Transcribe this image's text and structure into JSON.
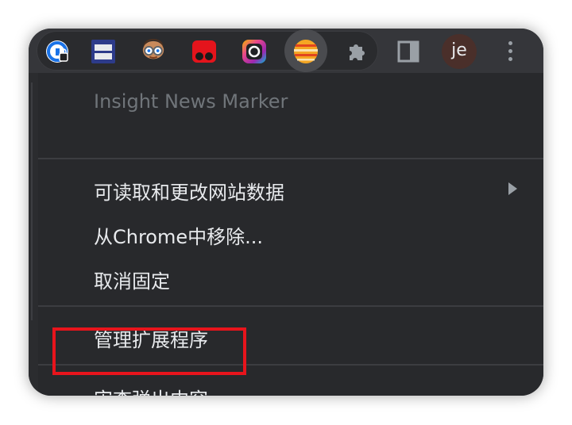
{
  "toolbar": {
    "extensions": [
      {
        "icon": "password-manager-icon"
      },
      {
        "icon": "notes-extension-icon"
      },
      {
        "icon": "glasses-face-extension-icon"
      },
      {
        "icon": "red-gamepad-extension-icon"
      },
      {
        "icon": "rainbow-camera-extension-icon"
      },
      {
        "icon": "insight-news-marker-icon",
        "active": true
      },
      {
        "icon": "puzzle-icon"
      },
      {
        "icon": "side-panel-icon"
      }
    ],
    "avatar_text": "je",
    "menu_icon": "more-vertical-icon"
  },
  "menu": {
    "title": "Insight News Marker",
    "items": [
      {
        "label": "可读取和更改网站数据",
        "has_submenu": true
      },
      {
        "label": "从Chrome中移除..."
      },
      {
        "label": "取消固定"
      },
      {
        "label": "管理扩展程序"
      },
      {
        "label": "审查弹出内容",
        "highlighted": true
      }
    ]
  },
  "colors": {
    "background": "#202124",
    "menu_bg": "#28292c",
    "text": "#e8eaed",
    "muted_text": "#70757a",
    "highlight_border": "#e8141c"
  }
}
